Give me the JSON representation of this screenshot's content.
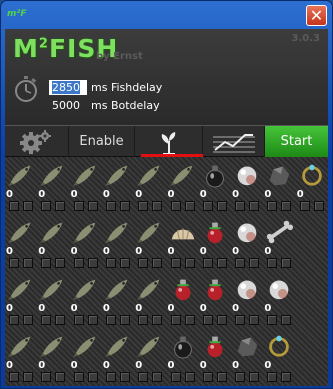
{
  "window": {
    "app_icon_text": "m²F",
    "close_glyph": "✕"
  },
  "header": {
    "logo_main": "M",
    "logo_sup": "2",
    "logo_rest": "FISH",
    "byline": "by Ernst",
    "version": "3.0.3",
    "fishdelay_value": "2850",
    "fishdelay_label": "ms Fishdelay",
    "botdelay_value": "5000",
    "botdelay_label": "ms Botdelay"
  },
  "toolbar": {
    "settings_icon": "gear-icon",
    "enable_label": "Enable",
    "plant_icon": "plant-icon",
    "chart_icon": "chart-icon",
    "start_label": "Start"
  },
  "colors": {
    "accent_green": "#3fb833",
    "selected_tab_underline": "#e01010",
    "logo_green": "#7fe060"
  },
  "grid": {
    "rows": [
      [
        {
          "icon": "fish-icon",
          "count": "0"
        },
        {
          "icon": "fish-icon",
          "count": "0"
        },
        {
          "icon": "fish-icon",
          "count": "0"
        },
        {
          "icon": "fish-icon",
          "count": "0"
        },
        {
          "icon": "fish-icon",
          "count": "0"
        },
        {
          "icon": "fish-icon",
          "count": "0"
        },
        {
          "icon": "bag-icon",
          "count": "0"
        },
        {
          "icon": "pearl-icon",
          "count": "0"
        },
        {
          "icon": "ore-icon",
          "count": "0"
        },
        {
          "icon": "ring-icon",
          "count": "0"
        }
      ],
      [
        {
          "icon": "fish-icon",
          "count": "0"
        },
        {
          "icon": "fish-icon",
          "count": "0"
        },
        {
          "icon": "fish-icon",
          "count": "0"
        },
        {
          "icon": "fish-icon",
          "count": "0"
        },
        {
          "icon": "fish-icon",
          "count": "0"
        },
        {
          "icon": "shell-icon",
          "count": "0"
        },
        {
          "icon": "potion-icon",
          "count": "0"
        },
        {
          "icon": "pearl-icon",
          "count": "0"
        },
        {
          "icon": "bone-icon",
          "count": "0"
        }
      ],
      [
        {
          "icon": "fish-icon",
          "count": "0"
        },
        {
          "icon": "fish-icon",
          "count": "0"
        },
        {
          "icon": "fish-icon",
          "count": "0"
        },
        {
          "icon": "fish-icon",
          "count": "0"
        },
        {
          "icon": "fish-icon",
          "count": "0"
        },
        {
          "icon": "potion-icon",
          "count": "0"
        },
        {
          "icon": "potion-icon",
          "count": "0"
        },
        {
          "icon": "pearl-icon",
          "count": "0"
        },
        {
          "icon": "pearl-icon",
          "count": "0"
        }
      ],
      [
        {
          "icon": "fish-icon",
          "count": "0"
        },
        {
          "icon": "fish-icon",
          "count": "0"
        },
        {
          "icon": "fish-icon",
          "count": "0"
        },
        {
          "icon": "fish-icon",
          "count": "0"
        },
        {
          "icon": "fish-icon",
          "count": "0"
        },
        {
          "icon": "bag-icon",
          "count": "0"
        },
        {
          "icon": "potion-icon",
          "count": "0"
        },
        {
          "icon": "ore-icon",
          "count": "0"
        },
        {
          "icon": "ring-icon",
          "count": "0"
        }
      ]
    ]
  }
}
